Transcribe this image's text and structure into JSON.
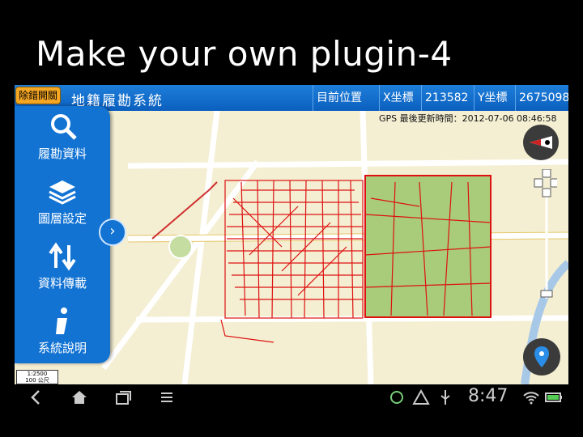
{
  "slide": {
    "title": "Make your own plugin-4"
  },
  "app": {
    "debug_toggle": "除錯開關",
    "title": "地籍履勘系統",
    "position_label": "目前位置",
    "x_label": "X坐標",
    "x_value": "213582",
    "y_label": "Y坐標",
    "y_value": "2675098",
    "gps_update": "GPS 最後更新時間：2012-07-06 08:46:58"
  },
  "sidebar": {
    "items": [
      {
        "label": "履勘資料",
        "icon": "magnifier-icon"
      },
      {
        "label": "圖層設定",
        "icon": "layers-icon"
      },
      {
        "label": "資料傳載",
        "icon": "transfer-arrows-icon"
      },
      {
        "label": "系統說明",
        "icon": "info-icon"
      }
    ]
  },
  "scale": {
    "ratio": "1:2500",
    "distance": "100 公尺"
  },
  "statusbar": {
    "time": "8:47"
  },
  "colors": {
    "topbar": "#1273d3",
    "parcel": "#dd1111",
    "green_zone": "#a8cc7a",
    "map_bg": "#f4efd2",
    "road": "#ffffff"
  }
}
